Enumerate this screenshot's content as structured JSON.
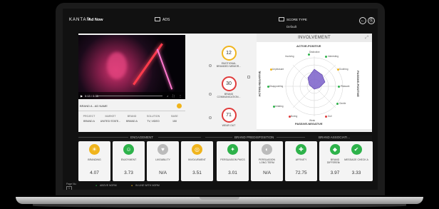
{
  "header": {
    "brand": "KANTAR",
    "ad_name": "Ad Now",
    "ads_label": "ADS",
    "score_type_label": "SCORE TYPE",
    "score_type_value": "Default"
  },
  "video": {
    "time": "0:13 / 0:35",
    "brand_label": "BRAND A - AD NAME"
  },
  "meta": {
    "columns": [
      {
        "label": "PROJECT",
        "value": "BRAND A"
      },
      {
        "label": "MARKET",
        "value": "UNITED STATE..."
      },
      {
        "label": "BRAND",
        "value": "BRAND A"
      },
      {
        "label": "SOLUTION",
        "value": "TV, VIDEO"
      },
      {
        "label": "BASE",
        "value": "150"
      }
    ]
  },
  "kpis": [
    {
      "value": "12",
      "label_1": "EMOTIONAL",
      "label_2": "BRANDED MEMOR...",
      "color": "#f0b41c"
    },
    {
      "value": "30",
      "label_1": "BRAND",
      "label_2": "COMMUNICATION...",
      "color": "#e03a3a"
    },
    {
      "value": "71",
      "label_1": "WEAR OUT",
      "label_2": "",
      "color": "#e03a3a"
    }
  ],
  "involvement": {
    "title": "INVOLVEMENT",
    "top_axis": "ACTIVE-POSITIVE",
    "bottom_axis": "PASSIVE-NEGATIVE",
    "left_axis": "ACTIVE-NEGATIVE",
    "right_axis": "PASSIVE-POSITIVE",
    "labels": [
      "Distinctive",
      "Interesting",
      "Involving",
      "Soothing",
      "Pleasant",
      "Gentle",
      "Dull",
      "Boring",
      "Irritating",
      "Disappointing",
      "Unpleasant",
      "Weak"
    ],
    "dot_colors": {
      "green": "#2db24a",
      "red": "#e03a3a",
      "yellow": "#f0b41c"
    },
    "shape_color": "#7a5fc9"
  },
  "sections": {
    "engagement": "ENGAGEMENT",
    "brand_predisposition": "BRAND PREDISPOSITION",
    "brand_association": "BRAND ASSOCIATI..."
  },
  "cards": [
    {
      "label_1": "BRANDING",
      "label_2": "",
      "value": "4.07",
      "color": "#f0b41c",
      "icon": "☀"
    },
    {
      "label_1": "ENJOYMENT",
      "label_2": "",
      "value": "3.73",
      "color": "#2db24a",
      "icon": "☺"
    },
    {
      "label_1": "LIKEABILITY",
      "label_2": "",
      "value": "N/A",
      "color": "#bbbbbb",
      "icon": "♥"
    },
    {
      "label_1": "INVOLVEMENT",
      "label_2": "",
      "value": "3.51",
      "color": "#f0b41c",
      "icon": "◎"
    },
    {
      "label_1": "PERSUASION PWCS",
      "label_2": "",
      "value": "3.01",
      "color": "#2db24a",
      "icon": "✦"
    },
    {
      "label_1": "PERSUASION",
      "label_2": "LONG TERM",
      "value": "N/A",
      "color": "#bbbbbb",
      "icon": "◐"
    },
    {
      "label_1": "AFFINITY",
      "label_2": "",
      "value": "72.75",
      "color": "#2db24a",
      "icon": "✚"
    },
    {
      "label_1": "BRAND",
      "label_2": "DIFFERENCE",
      "value": "3.97",
      "color": "#2db24a",
      "icon": "◆"
    },
    {
      "label_1": "MESSAGE CHECK A",
      "label_2": "",
      "value": "3.33",
      "color": "#2db24a",
      "icon": "✔"
    }
  ],
  "legend": {
    "page_label": "Page Nu",
    "page_value": "1",
    "above_norm": "ABOVE NORM",
    "in_line": "IN LINE WITH NORM"
  }
}
